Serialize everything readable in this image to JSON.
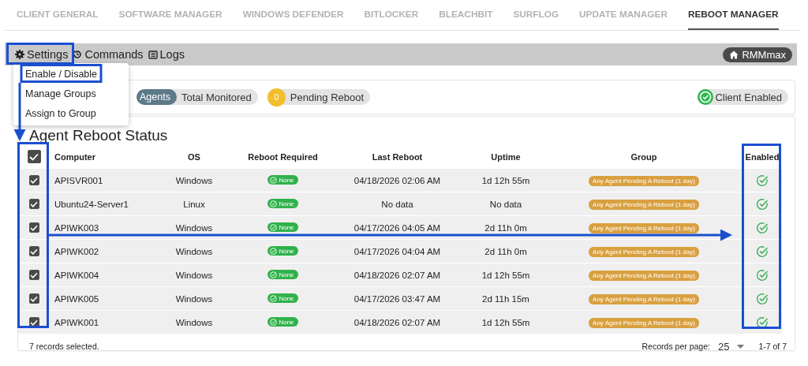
{
  "tabs": [
    {
      "label": "CLIENT GENERAL",
      "selected": false
    },
    {
      "label": "SOFTWARE MANAGER",
      "selected": false
    },
    {
      "label": "WINDOWS DEFENDER",
      "selected": false
    },
    {
      "label": "BITLOCKER",
      "selected": false
    },
    {
      "label": "BLEACHBIT",
      "selected": false
    },
    {
      "label": "SURFLOG",
      "selected": false
    },
    {
      "label": "UPDATE MANAGER",
      "selected": false
    },
    {
      "label": "REBOOT MANAGER",
      "selected": true
    }
  ],
  "toolbar": {
    "items": [
      {
        "kind": "gear",
        "label": "Settings"
      },
      {
        "kind": "cycle",
        "label": "Commands"
      },
      {
        "kind": "log",
        "label": "Logs"
      }
    ],
    "home_chip": "RMMmax"
  },
  "settings_menu": {
    "items": [
      "Enable / Disable",
      "Manage Groups",
      "Assign to Group"
    ]
  },
  "stats": {
    "agents": "Agents",
    "total": "Total Monitored",
    "pending_count": "0",
    "pending": "Pending Reboot",
    "client_status": "Client Enabled"
  },
  "table": {
    "title": "Agent Reboot Status",
    "all_checked": true,
    "columns": [
      "Computer",
      "OS",
      "Reboot Required",
      "Last Reboot",
      "Uptime",
      "Group",
      "Enabled"
    ],
    "rows": [
      {
        "checked": true,
        "computer": "APISVR001",
        "os": "Windows",
        "reboot_required": "None",
        "last_reboot": "04/18/2026 02:06 AM",
        "uptime": "1d 12h 55m",
        "group": "Any Agent Pending A Reboot (1 day)",
        "enabled": true
      },
      {
        "checked": true,
        "computer": "Ubuntu24-Server1",
        "os": "Linux",
        "reboot_required": "None",
        "last_reboot": "No data",
        "uptime": "No data",
        "group": "Any Agent Pending A Reboot (1 day)",
        "enabled": true
      },
      {
        "checked": true,
        "computer": "APIWK003",
        "os": "Windows",
        "reboot_required": "None",
        "last_reboot": "04/17/2026 04:05 AM",
        "uptime": "2d 11h 0m",
        "group": "Any Agent Pending A Reboot (1 day)",
        "enabled": true
      },
      {
        "checked": true,
        "computer": "APIWK002",
        "os": "Windows",
        "reboot_required": "None",
        "last_reboot": "04/17/2026 04:04 AM",
        "uptime": "2d 11h 0m",
        "group": "Any Agent Pending A Reboot (1 day)",
        "enabled": true
      },
      {
        "checked": true,
        "computer": "APIWK004",
        "os": "Windows",
        "reboot_required": "None",
        "last_reboot": "04/18/2026 02:07 AM",
        "uptime": "1d 12h 55m",
        "group": "Any Agent Pending A Reboot (1 day)",
        "enabled": true
      },
      {
        "checked": true,
        "computer": "APIWK005",
        "os": "Windows",
        "reboot_required": "None",
        "last_reboot": "04/17/2026 03:47 AM",
        "uptime": "2d 11h 15m",
        "group": "Any Agent Pending A Reboot (1 day)",
        "enabled": true
      },
      {
        "checked": true,
        "computer": "APIWK001",
        "os": "Windows",
        "reboot_required": "None",
        "last_reboot": "04/18/2026 02:07 AM",
        "uptime": "1d 12h 55m",
        "group": "Any Agent Pending A Reboot (1 day)",
        "enabled": true
      }
    ],
    "footer": {
      "selected_count": "7 records selected.",
      "per_page_label": "Records per page:",
      "per_page": "25",
      "range": "1-7 of 7"
    }
  }
}
